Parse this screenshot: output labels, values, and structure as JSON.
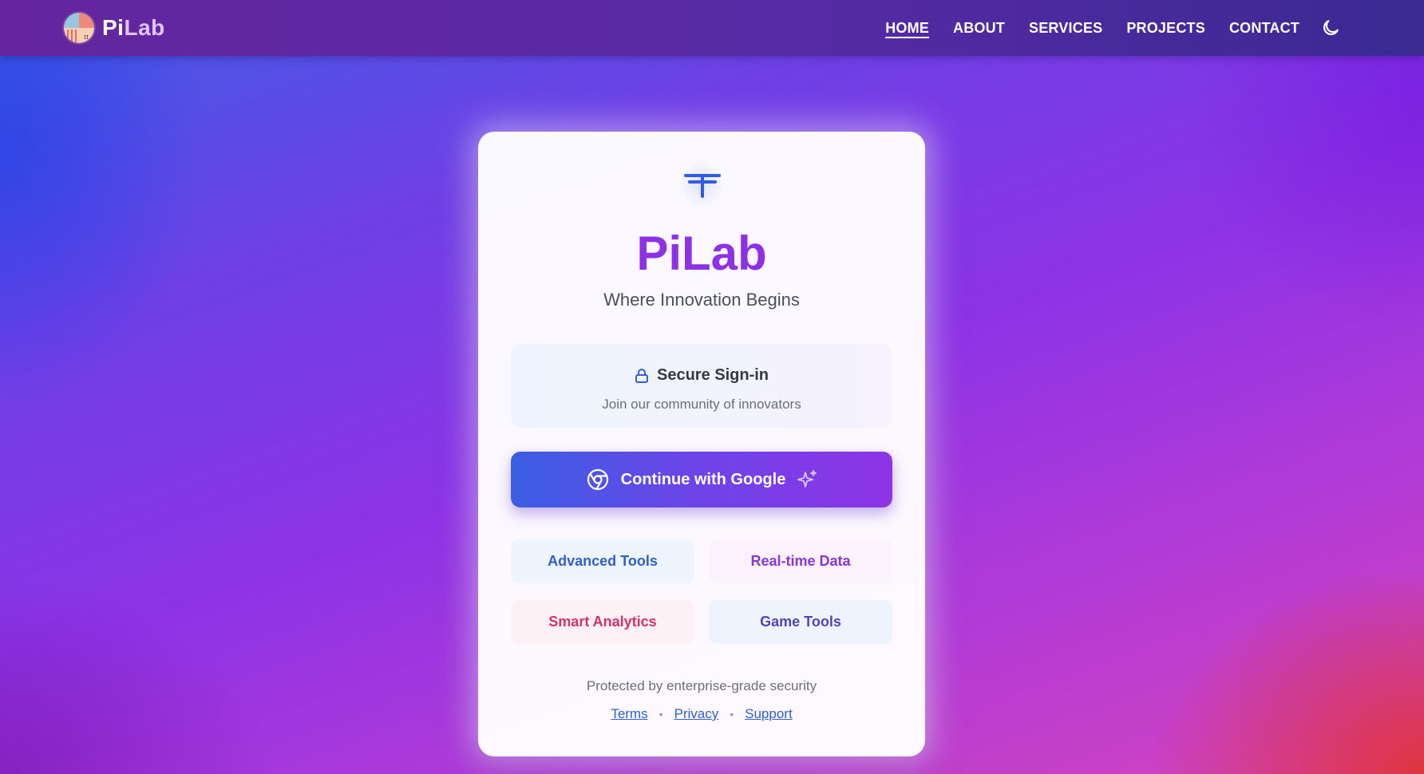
{
  "nav": {
    "brand": {
      "part1": "Pi",
      "part2": "Lab",
      "logo_icon": "pilab-logo-icon"
    },
    "links": [
      {
        "label": "HOME",
        "active": true
      },
      {
        "label": "ABOUT",
        "active": false
      },
      {
        "label": "SERVICES",
        "active": false
      },
      {
        "label": "PROJECTS",
        "active": false
      },
      {
        "label": "CONTACT",
        "active": false
      }
    ],
    "theme_toggle_icon": "moon-icon"
  },
  "card": {
    "hero_icon": "pi-icon",
    "title": "PiLab",
    "subtitle": "Where Innovation Begins",
    "secure": {
      "icon": "lock-icon",
      "title": "Secure Sign-in",
      "subtitle": "Join our community of innovators"
    },
    "google_button": {
      "label": "Continue with Google",
      "icon": "chrome-icon",
      "trailing_icon": "sparkles-icon"
    },
    "features": [
      "Advanced Tools",
      "Real-time Data",
      "Smart Analytics",
      "Game Tools"
    ],
    "protected_text": "Protected by enterprise-grade security",
    "footer_links": [
      "Terms",
      "Privacy",
      "Support"
    ],
    "footer_separator": "•"
  },
  "colors": {
    "nav_bg": "#5a27a2",
    "title": "#8e30e6",
    "button_start": "#3a5fe3",
    "button_end": "#8e33e6",
    "link": "#2f5fd0"
  }
}
